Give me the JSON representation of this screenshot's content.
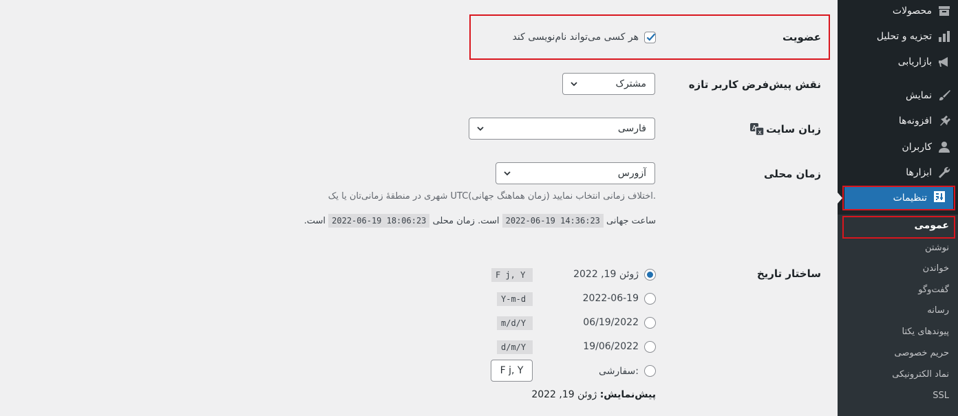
{
  "sidebar": {
    "items": [
      {
        "label": "محصولات",
        "icon": "archive-icon"
      },
      {
        "label": "تجزیه و تحلیل",
        "icon": "bar-chart-icon"
      },
      {
        "label": "بازاریابی",
        "icon": "megaphone-icon"
      },
      {
        "label": "نمایش",
        "icon": "brush-icon"
      },
      {
        "label": "افزونه‌ها",
        "icon": "plugin-icon"
      },
      {
        "label": "کاربران",
        "icon": "user-icon"
      },
      {
        "label": "ابزارها",
        "icon": "wrench-icon"
      }
    ],
    "active": {
      "label": "تنظیمات",
      "icon": "settings-icon"
    },
    "submenu": {
      "current": "عمومی",
      "items": [
        "نوشتن",
        "خواندن",
        "گفت‌وگو",
        "رسانه",
        "پیوندهای یکتا",
        "حریم خصوصی",
        "نماد الکترونیکی",
        "SSL"
      ]
    }
  },
  "main": {
    "membership": {
      "label": "عضویت",
      "checkbox_label": "هر کسی می‌تواند نام‌نویسی کند",
      "checked": true
    },
    "default_role": {
      "label": "نقش پیش‌فرض کاربر تازه",
      "value": "مشترک"
    },
    "site_language": {
      "label": "زبان سایت",
      "value": "فارسی",
      "icon": "translation-icon"
    },
    "timezone": {
      "label": "زمان محلی",
      "value": "آزورس",
      "description": "شهری در منطقهٔ زمانی‌تان یا یک UTC(زمان هماهنگ جهانی) اختلاف زمانی انتخاب نمایید.",
      "utc_prefix": "ساعت جهانی",
      "utc_time": "2022-06-19 14:36:23",
      "local_prefix": "است. زمان محلی",
      "local_time": "2022-06-19 18:06:23",
      "suffix": "است."
    },
    "date_format": {
      "label": "ساختار تاریخ",
      "options": [
        {
          "display": "ژوئن 19, 2022",
          "code": "F j, Y",
          "checked": true
        },
        {
          "display": "2022-06-19",
          "code": "Y-m-d",
          "checked": false
        },
        {
          "display": "06/19/2022",
          "code": "m/d/Y",
          "checked": false
        },
        {
          "display": "19/06/2022",
          "code": "d/m/Y",
          "checked": false
        }
      ],
      "custom_label": "سفارشی:",
      "custom_value": "F j, Y",
      "preview_label": "پیش‌نمایش:",
      "preview_value": "ژوئن 19, 2022"
    }
  },
  "colors": {
    "accent": "#2271b1",
    "highlight": "#d9161e",
    "sidebar_bg": "#1d2327"
  }
}
